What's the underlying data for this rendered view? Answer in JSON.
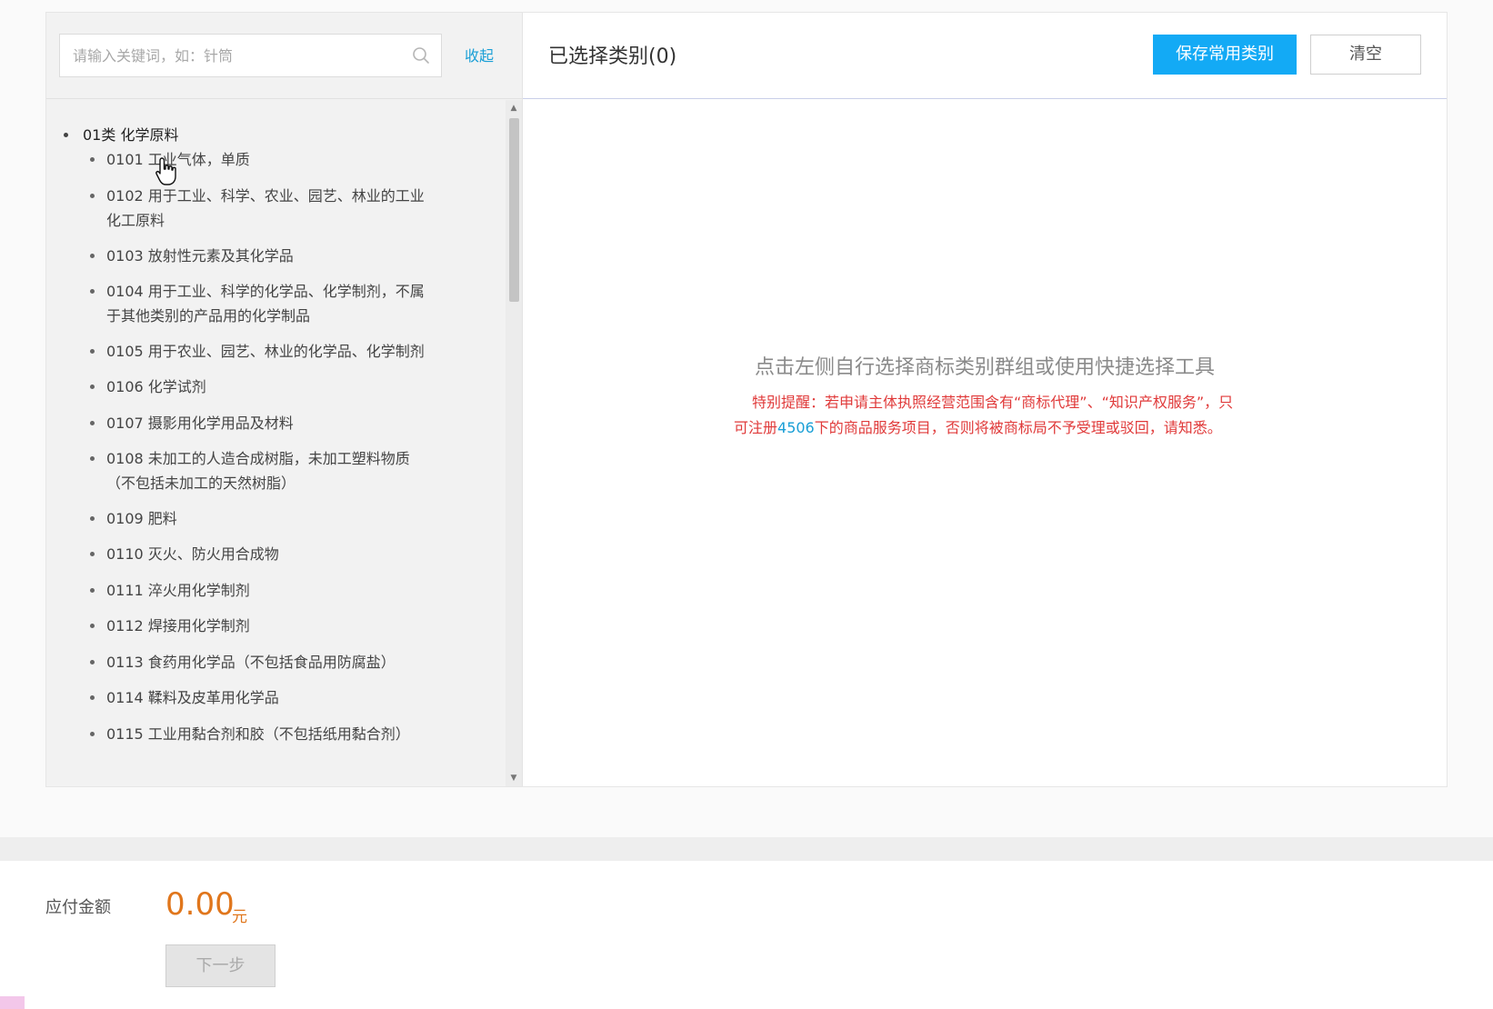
{
  "search": {
    "placeholder": "请输入关键词，如：针筒"
  },
  "collapse_label": "收起",
  "category": {
    "label": "01类 化学原料"
  },
  "subcategories": [
    {
      "lines": [
        "0101 工业气体，单质"
      ]
    },
    {
      "lines": [
        "0102 用于工业、科学、农业、园艺、林业的工业",
        "化工原料"
      ]
    },
    {
      "lines": [
        "0103 放射性元素及其化学品"
      ]
    },
    {
      "lines": [
        "0104 用于工业、科学的化学品、化学制剂，不属",
        "于其他类别的产品用的化学制品"
      ]
    },
    {
      "lines": [
        "0105 用于农业、园艺、林业的化学品、化学制剂"
      ]
    },
    {
      "lines": [
        "0106 化学试剂"
      ]
    },
    {
      "lines": [
        "0107 摄影用化学用品及材料"
      ]
    },
    {
      "lines": [
        "0108 未加工的人造合成树脂，未加工塑料物质",
        "（不包括未加工的天然树脂）"
      ]
    },
    {
      "lines": [
        "0109 肥料"
      ]
    },
    {
      "lines": [
        "0110 灭火、防火用合成物"
      ]
    },
    {
      "lines": [
        "0111 淬火用化学制剂"
      ]
    },
    {
      "lines": [
        "0112 焊接用化学制剂"
      ]
    },
    {
      "lines": [
        "0113 食药用化学品（不包括食品用防腐盐）"
      ]
    },
    {
      "lines": [
        "0114 鞣料及皮革用化学品"
      ]
    },
    {
      "lines": [
        "0115 工业用黏合剂和胶（不包括纸用黏合剂）"
      ]
    }
  ],
  "selected": {
    "title": "已选择类别(0)"
  },
  "buttons": {
    "save_label": "保存常用类别",
    "clear_label": "清空",
    "next_label": "下一步"
  },
  "hint": {
    "main": "点击左侧自行选择商标类别群组或使用快捷选择工具",
    "warning_line1": "特别提醒：若申请主体执照经营范围含有“商标代理”、“知识产权服务”，只",
    "warning_prefix": "可注册",
    "warning_count": "4506",
    "warning_suffix": "下的商品服务项目，否则将被商标局不予受理或驳回，请知悉。"
  },
  "payment": {
    "label": "应付金额",
    "amount": "0.00",
    "unit": "元"
  },
  "colors": {
    "accent": "#13aaf5",
    "link": "#1a9fd6",
    "price": "#e0761c",
    "warning": "#e03a3a"
  },
  "icons": {
    "search": "search-icon",
    "cursor": "hand-cursor-icon"
  }
}
